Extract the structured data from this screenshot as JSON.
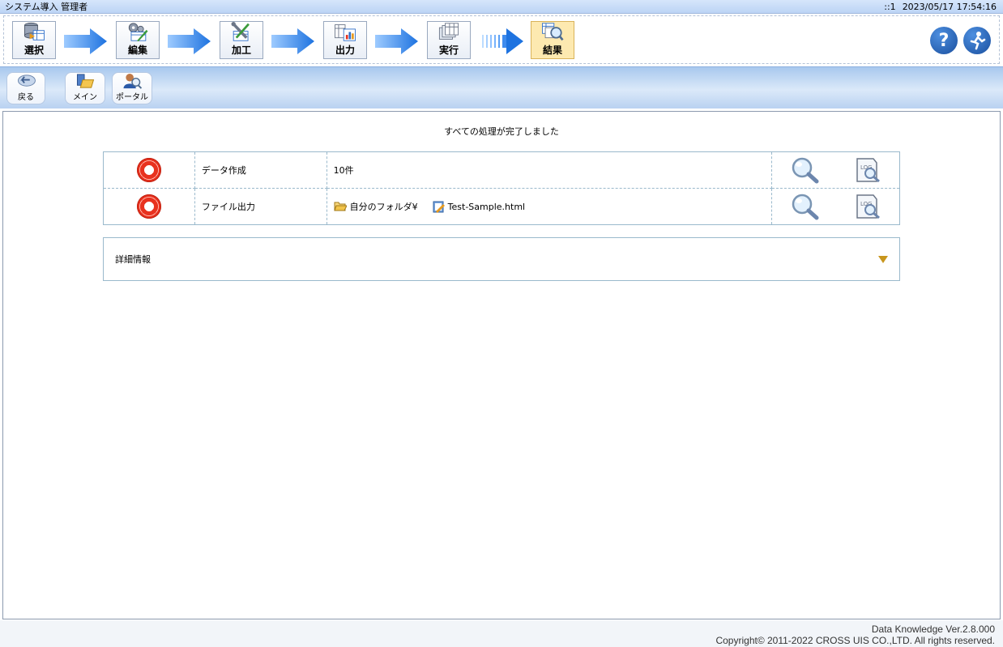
{
  "titlebar": {
    "title": "システム導入 管理者",
    "session": "::1",
    "datetime": "2023/05/17 17:54:16"
  },
  "workflow": {
    "steps": [
      {
        "label": "選択",
        "icon": "database-select-icon",
        "active": false
      },
      {
        "label": "編集",
        "icon": "gear-edit-icon",
        "active": false
      },
      {
        "label": "加工",
        "icon": "tools-icon",
        "active": false
      },
      {
        "label": "出力",
        "icon": "output-chart-icon",
        "active": false
      },
      {
        "label": "実行",
        "icon": "execute-table-icon",
        "active": false
      },
      {
        "label": "結果",
        "icon": "result-magnifier-icon",
        "active": true
      }
    ],
    "help_icon": "help-icon",
    "logout_icon": "logout-icon",
    "help_label": "?"
  },
  "subtoolbar": {
    "back_label": "戻る",
    "main_label": "メイン",
    "portal_label": "ポータル"
  },
  "main": {
    "message": "すべての処理が完了しました",
    "rows": [
      {
        "status": "success",
        "name": "データ作成",
        "detail": "10件"
      },
      {
        "status": "success",
        "name": "ファイル出力",
        "folder": "自分のフォルダ¥",
        "file": "Test-Sample.html"
      }
    ],
    "detail_label": "詳細情報"
  },
  "footer": {
    "version": "Data Knowledge Ver.2.8.000",
    "copyright": "Copyright© 2011‐2022 CROSS UIS CO.,LTD. All rights reserved."
  },
  "colors": {
    "accent_blue": "#2f7fe6",
    "active_step": "#fde9b0",
    "status_red": "#e8321f"
  }
}
